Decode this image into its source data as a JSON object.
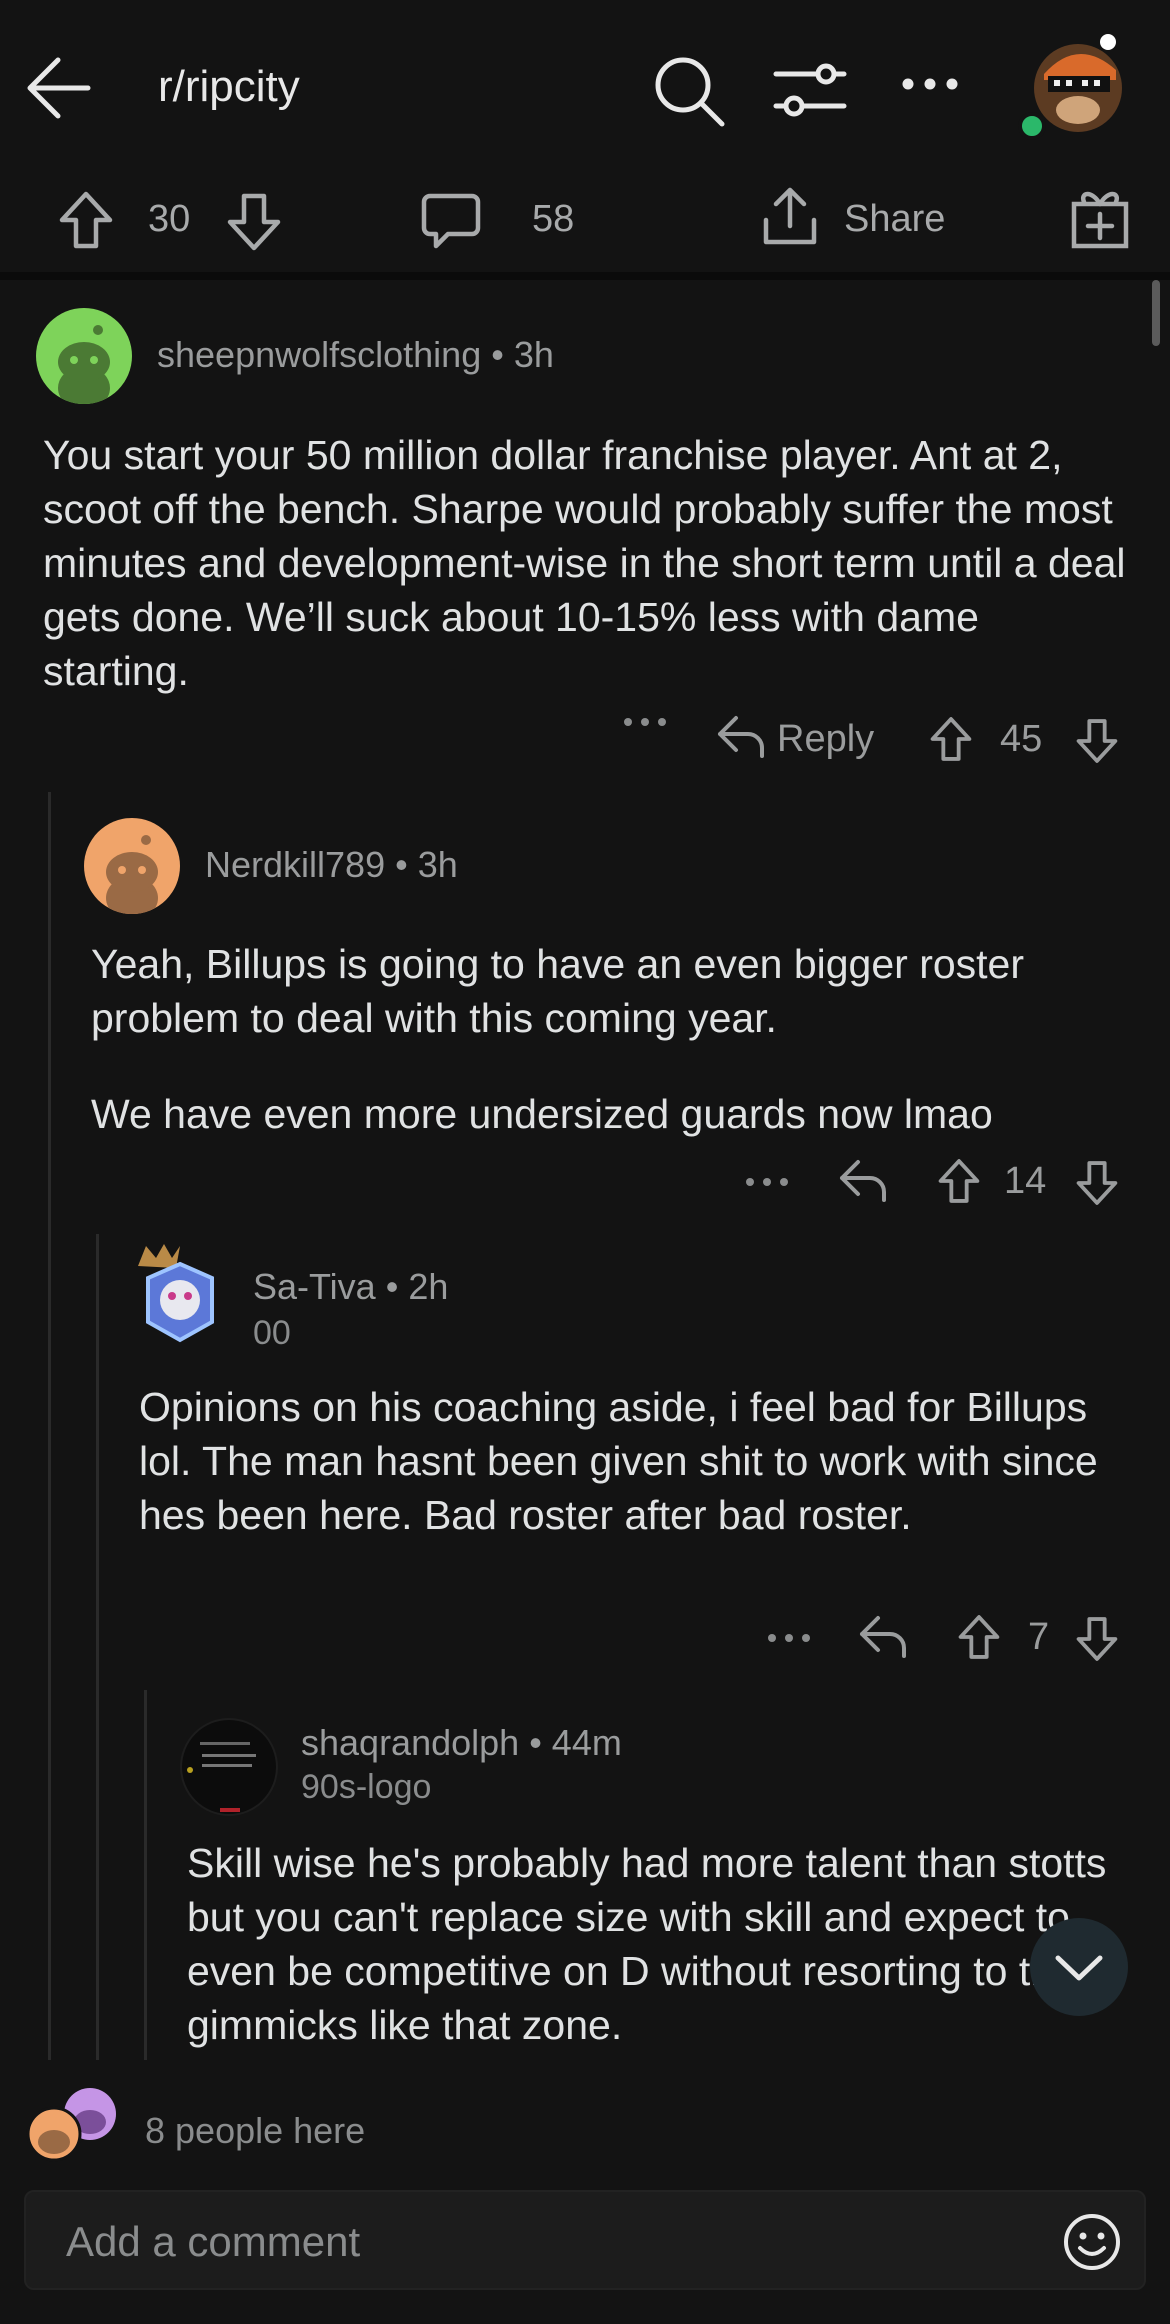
{
  "header": {
    "title": "r/ripcity",
    "icons": [
      "back-arrow-icon",
      "search-icon",
      "filter-icon",
      "more-icon",
      "avatar"
    ]
  },
  "post_actions": {
    "upvotes": "30",
    "comments": "58",
    "share_label": "Share"
  },
  "comments": [
    {
      "author": "sheepnwolfsclothing",
      "time": "3h",
      "flair": "",
      "body": "You start your 50 million dollar franchise player. Ant at 2, scoot off the bench. Sharpe would probably suffer the most minutes and development-wise in the short term until a deal gets done. We’ll suck about 10-15% less with dame starting.",
      "reply_label": "Reply",
      "votes": "45"
    },
    {
      "author": "Nerdkill789",
      "time": "3h",
      "flair": "",
      "body": "Yeah, Billups is going to have an even bigger roster problem to deal with this coming year.",
      "body2": "We have even more undersized guards now lmao",
      "votes": "14"
    },
    {
      "author": "Sa-Tiva",
      "time": "2h",
      "flair": "00",
      "body": "Opinions on his coaching aside, i feel bad for Billups lol. The man hasnt been given shit to work with since hes been here. Bad roster after bad roster.",
      "votes": "7"
    },
    {
      "author": "shaqrandolph",
      "time": "44m",
      "flair": "90s-logo",
      "body": "Skill wise he's probably had more talent than stotts but you can't replace size with skill and expect to even be competitive on D without resorting to the gimmicks like that zone."
    }
  ],
  "presence": {
    "text": "8 people here"
  },
  "composer": {
    "placeholder": "Add a comment"
  },
  "colors": {
    "background": "#131313",
    "text": "#d7dadc",
    "muted": "#8a8c8d",
    "online": "#2bb86a"
  }
}
